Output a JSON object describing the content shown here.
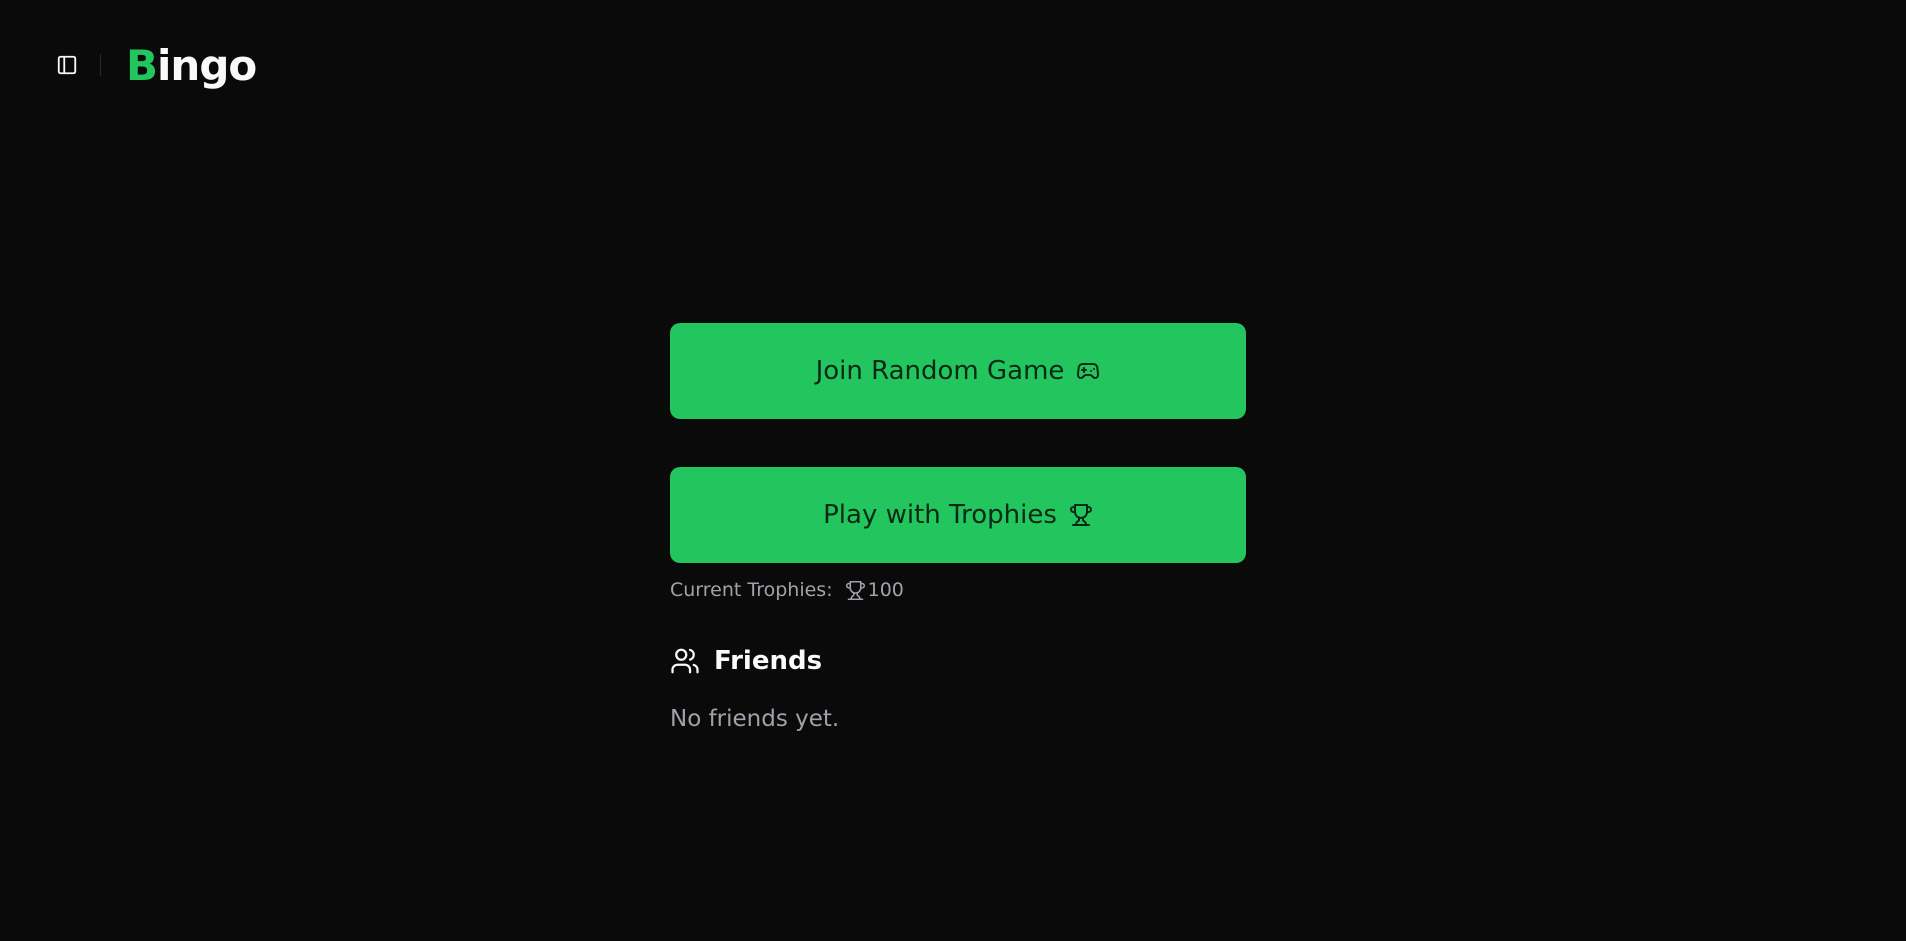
{
  "header": {
    "logo_accent": "B",
    "logo_rest": "ingo",
    "toggle_icon": "sidebar-toggle-icon"
  },
  "actions": {
    "join_random_label": "Join Random Game",
    "join_random_icon": "gamepad-icon",
    "play_trophies_label": "Play with Trophies",
    "play_trophies_icon": "trophy-icon"
  },
  "trophies": {
    "label": "Current Trophies:",
    "value": "100",
    "icon": "trophy-icon"
  },
  "friends": {
    "title": "Friends",
    "icon": "users-icon",
    "empty_text": "No friends yet."
  },
  "colors": {
    "background": "#0a0a0a",
    "accent": "#22c55e",
    "text": "#fafafa",
    "muted": "#a1a1aa"
  }
}
